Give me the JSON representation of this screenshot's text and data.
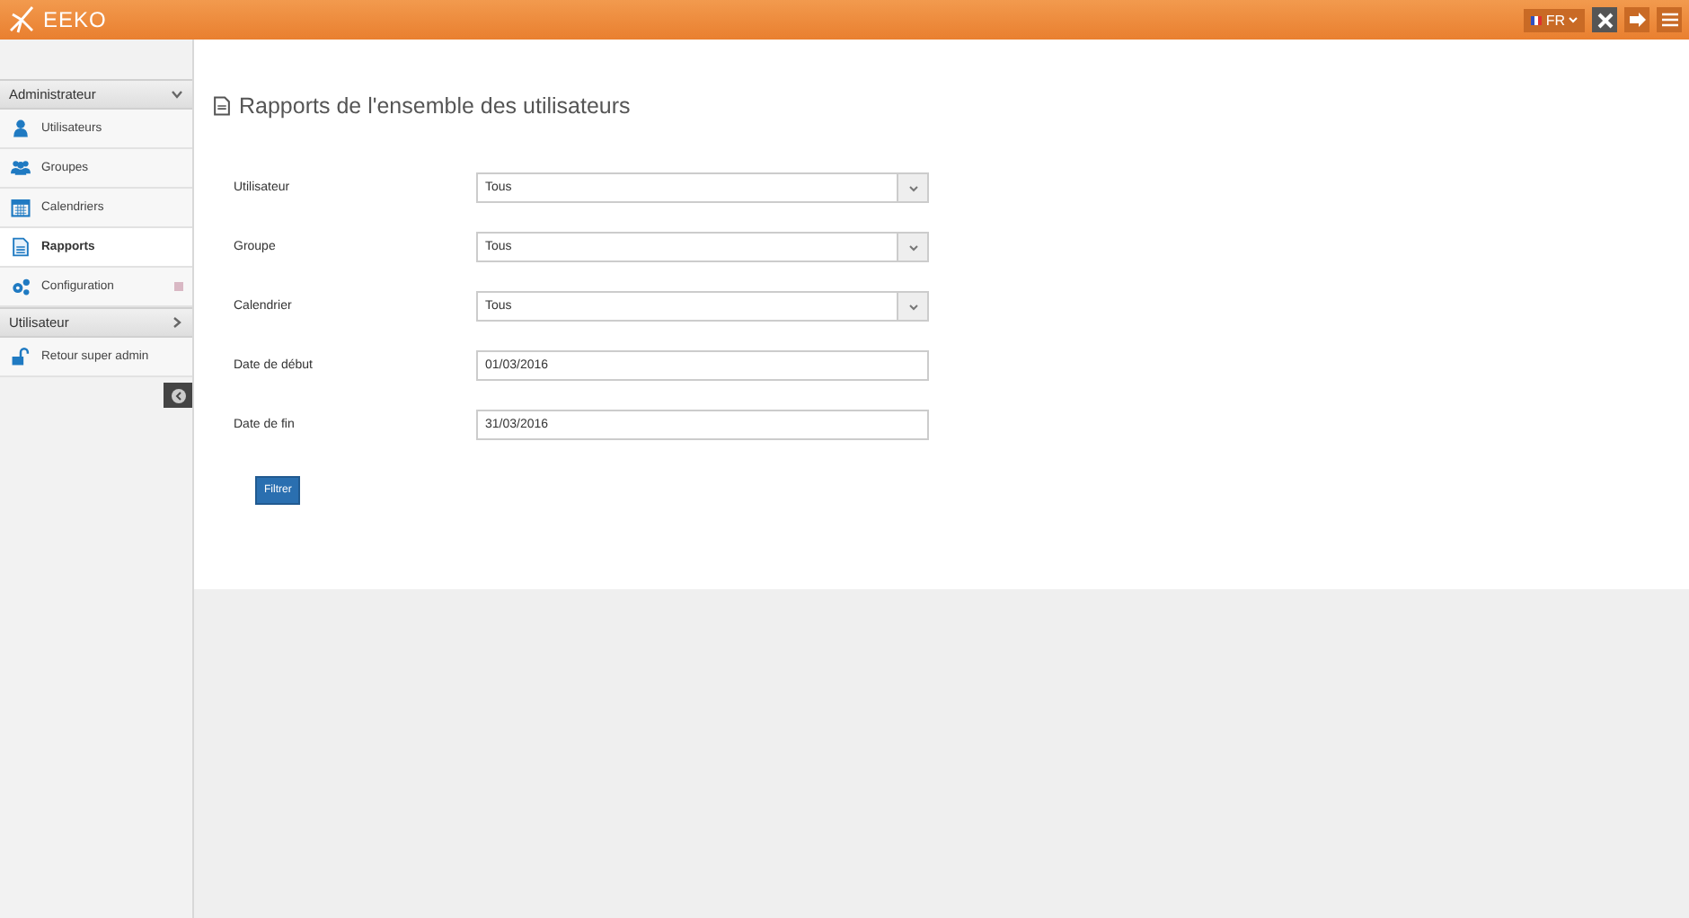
{
  "header": {
    "brand": "EEKO",
    "language": "FR"
  },
  "sidebar": {
    "sections": [
      {
        "title": "Administrateur",
        "expanded": true,
        "items": [
          {
            "label": "Utilisateurs",
            "kind": "user",
            "selected": false
          },
          {
            "label": "Groupes",
            "kind": "group",
            "selected": false
          },
          {
            "label": "Calendriers",
            "kind": "calendar",
            "selected": false
          },
          {
            "label": "Rapports",
            "kind": "document",
            "selected": true
          },
          {
            "label": "Configuration",
            "kind": "gears",
            "selected": false,
            "has_submenu": true
          }
        ]
      },
      {
        "title": "Utilisateur",
        "expanded": false,
        "items": [
          {
            "label": "Retour super admin",
            "kind": "unlock",
            "selected": false
          }
        ]
      }
    ]
  },
  "page": {
    "title": "Rapports de l'ensemble des utilisateurs",
    "fields": [
      {
        "label": "Utilisateur",
        "kind": "select",
        "value": "Tous"
      },
      {
        "label": "Groupe",
        "kind": "select",
        "value": "Tous"
      },
      {
        "label": "Calendrier",
        "kind": "select",
        "value": "Tous"
      },
      {
        "label": "Date de début",
        "kind": "date",
        "value": "01/03/2016"
      },
      {
        "label": "Date de fin",
        "kind": "date",
        "value": "31/03/2016"
      }
    ],
    "button": "Filtrer"
  }
}
